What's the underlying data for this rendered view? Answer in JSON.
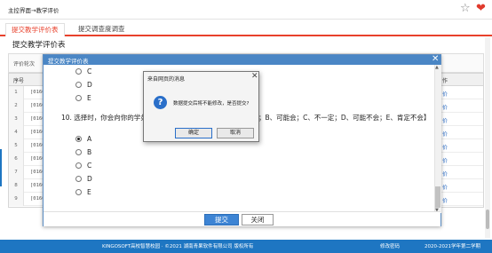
{
  "header": {
    "breadcrumb": "主控界面→教学评价",
    "icons": [
      "star-icon",
      "heart-icon"
    ],
    "heart_color": "#e03a2c"
  },
  "tabs": [
    {
      "label": "提交教学评价表",
      "active": true
    },
    {
      "label": "提交调查度调查",
      "active": false
    }
  ],
  "section_title": "提交教学评价表",
  "filter": {
    "label": "评价轮次"
  },
  "table": {
    "header_no": "序号",
    "header_op": "作",
    "rows": [
      {
        "num": "1",
        "code": "[0160",
        "op": "价"
      },
      {
        "num": "2",
        "code": "[0160",
        "op": "价"
      },
      {
        "num": "3",
        "code": "[0160",
        "op": "价"
      },
      {
        "num": "4",
        "code": "[0160",
        "op": "价"
      },
      {
        "num": "5",
        "code": "[0160",
        "op": "价"
      },
      {
        "num": "6",
        "code": "[0160",
        "op": "价"
      },
      {
        "num": "7",
        "code": "[0160",
        "op": "价"
      },
      {
        "num": "8",
        "code": "[0160",
        "op": "价"
      },
      {
        "num": "9",
        "code": "[0160",
        "op": "价"
      }
    ]
  },
  "eval_dialog": {
    "title": "提交教学评价表",
    "options_prev": [
      "C",
      "D",
      "E"
    ],
    "question": "10. 选择时，你会向你的学弟学妹推荐选这门课程吗？【A、肯定会；B、可能会；C、不一定；D、可能不会；E、肯定不会】",
    "options": [
      {
        "label": "A",
        "checked": true
      },
      {
        "label": "B",
        "checked": false
      },
      {
        "label": "C",
        "checked": false
      },
      {
        "label": "D",
        "checked": false
      },
      {
        "label": "E",
        "checked": false
      }
    ],
    "submit_label": "提交",
    "close_label": "关闭",
    "accent": "#4a86c5"
  },
  "alert": {
    "title": "来自网页的消息",
    "message": "数据提交后将不能修改，是否提交?",
    "ok_label": "确定",
    "cancel_label": "取消"
  },
  "footer": {
    "copyright": "KINGOSOFT高校智慧校园 · ©2021 湖南青果软件有限公司 版权所有",
    "change_password": "修改密码",
    "term": "2020-2021学年第二学期",
    "color": "#1e76c2"
  }
}
